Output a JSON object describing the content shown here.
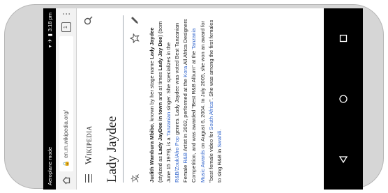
{
  "status_bar": {
    "left_text": "Aeroplane mode",
    "time": "3:18 pm"
  },
  "browser": {
    "url": "en.m.wikipedia.org/",
    "tab_count": "1"
  },
  "site": {
    "logo_text": "Wikipedia"
  },
  "page": {
    "title": "Lady Jaydee"
  },
  "article": {
    "p1_name": "Judith Wambura Mbibo",
    "p1_a": ", known by her stage name ",
    "p1_stage": "Lady Jaydee",
    "p1_b": " (stylized as ",
    "p1_styl": "Lady JayDee",
    "p1_c": " in town",
    "p1_d": " and at times ",
    "p1_times": "Lady Jay Dee",
    "p1_e": ") (born June 15 1979), is a ",
    "link_tanzanian": "Tanzanian",
    "p1_f": " singer. She specializes in the ",
    "link_genres": "R&B/Zouk/Afro Pop",
    "p1_g": " genres. Lady Jaydee was voted Best Tanzanian Female ",
    "link_rnb": "R&B",
    "p1_h": " Artist in 2002, performed at the ",
    "link_kora": "Kora",
    "p1_i": " All Africa Designers Competition, and was awarded \"Best R&B Album\" at the ",
    "link_tma": "Tanzania Music Awards",
    "p1_j": " on August 6, 2004. In July 2005, she won an award for \"best female video for ",
    "link_sa": "South Africa",
    "p1_k": "\". She was among the first females to sing R&B in ",
    "link_swahili": "Swahili",
    "p1_l": "."
  },
  "icons": {
    "home": "home-icon",
    "lock": "lock-icon",
    "menu": "more-vert-icon",
    "hamburger": "hamburger-icon",
    "search": "search-icon",
    "language": "language-icon",
    "star": "star-icon",
    "edit": "pencil-icon",
    "back": "back-triangle-icon",
    "home_nav": "home-circle-icon",
    "recents": "recents-square-icon"
  }
}
